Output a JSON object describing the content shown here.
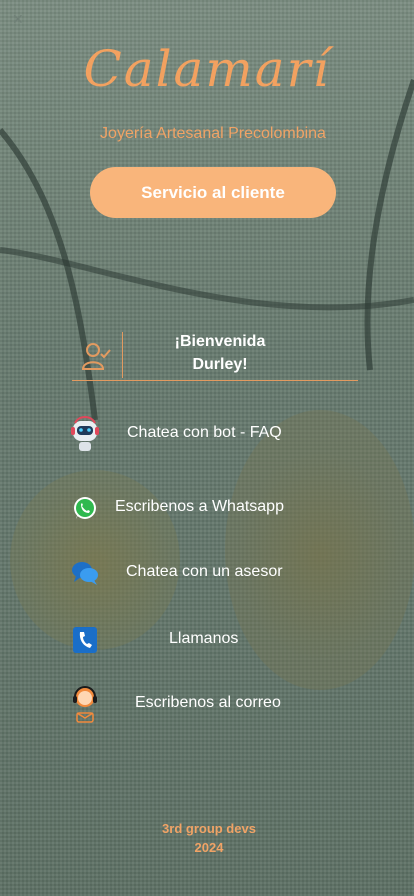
{
  "brand": {
    "name": "Calamarí",
    "tagline": "Joyería Artesanal Precolombina"
  },
  "cta": {
    "label": "Servicio al cliente"
  },
  "welcome": {
    "line1": "¡Bienvenida",
    "line2": "Durley!"
  },
  "menu": {
    "items": [
      {
        "label": "Chatea con bot - FAQ",
        "icon": "robot-icon"
      },
      {
        "label": "Escribenos a Whatsapp",
        "icon": "whatsapp-icon"
      },
      {
        "label": "Chatea con un asesor",
        "icon": "chat-bubbles-icon"
      },
      {
        "label": "Llamanos",
        "icon": "phone-icon"
      },
      {
        "label": "Escribenos al correo",
        "icon": "mail-agent-icon"
      }
    ]
  },
  "footer": {
    "line1": "3rd group devs",
    "line2": "2024"
  },
  "colors": {
    "accent": "#f2a160",
    "button": "#f9b57b",
    "text": "#ffffff"
  }
}
